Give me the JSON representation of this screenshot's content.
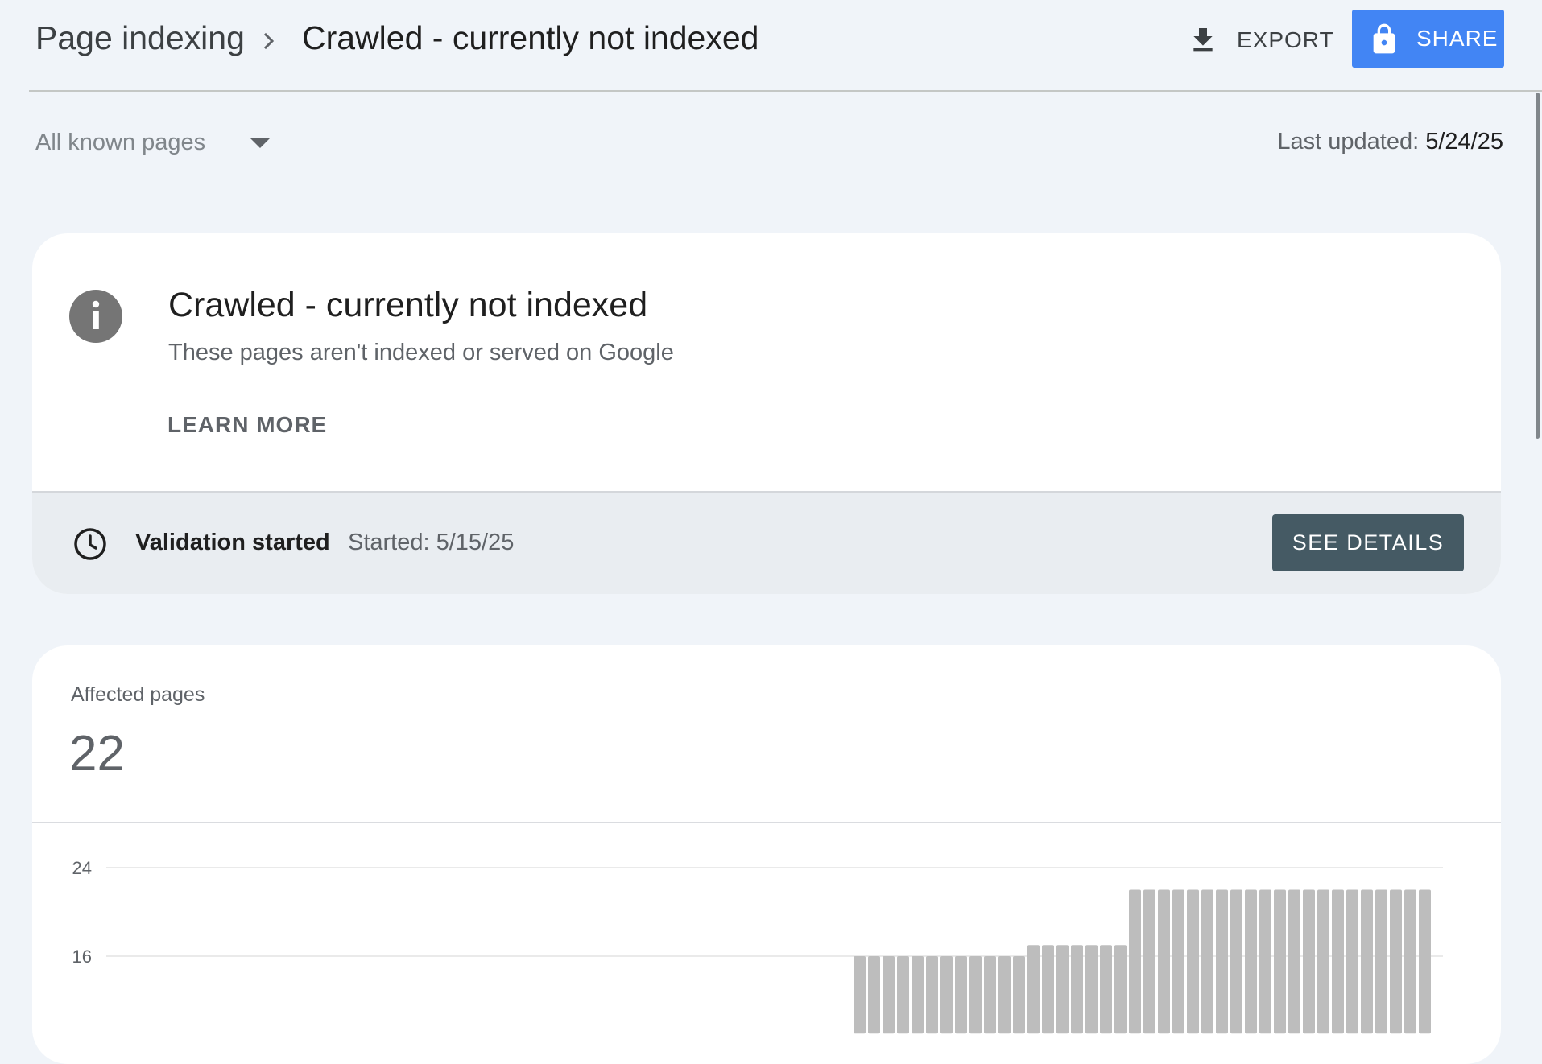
{
  "header": {
    "breadcrumb_root": "Page indexing",
    "breadcrumb_current": "Crawled - currently not indexed",
    "export_label": "EXPORT",
    "share_label": "SHARE"
  },
  "filter": {
    "selected": "All known pages"
  },
  "last_updated": {
    "label": "Last updated:",
    "value": "5/24/25"
  },
  "issue_card": {
    "title": "Crawled - currently not indexed",
    "subtitle": "These pages aren't indexed or served on Google",
    "learn_more": "LEARN MORE",
    "validation": {
      "status": "Validation started",
      "started": "Started: 5/15/25",
      "button": "SEE DETAILS"
    }
  },
  "affected": {
    "label": "Affected pages",
    "count": "22"
  },
  "colors": {
    "accent": "#4285f4",
    "see_details_bg": "#455a64",
    "bar": "#bdbdbd",
    "page_bg": "#f0f4f9"
  },
  "icons": {
    "export": "download-icon",
    "share": "lock-icon",
    "breadcrumb_separator": "chevron-right-icon",
    "filter": "caret-down-icon",
    "issue": "info-icon",
    "validation": "clock-icon"
  },
  "chart_data": {
    "type": "bar",
    "y_ticks": [
      "24",
      "16"
    ],
    "ylim_visible": [
      9,
      25
    ],
    "grid": true,
    "leading_empty_periods": 52,
    "values": [
      16,
      16,
      16,
      16,
      16,
      16,
      16,
      16,
      16,
      16,
      16,
      16,
      17,
      17,
      17,
      17,
      17,
      17,
      17,
      22,
      22,
      22,
      22,
      22,
      22,
      22,
      22,
      22,
      22,
      22,
      22,
      22,
      22,
      22,
      22,
      22,
      22,
      22,
      22,
      22
    ]
  }
}
